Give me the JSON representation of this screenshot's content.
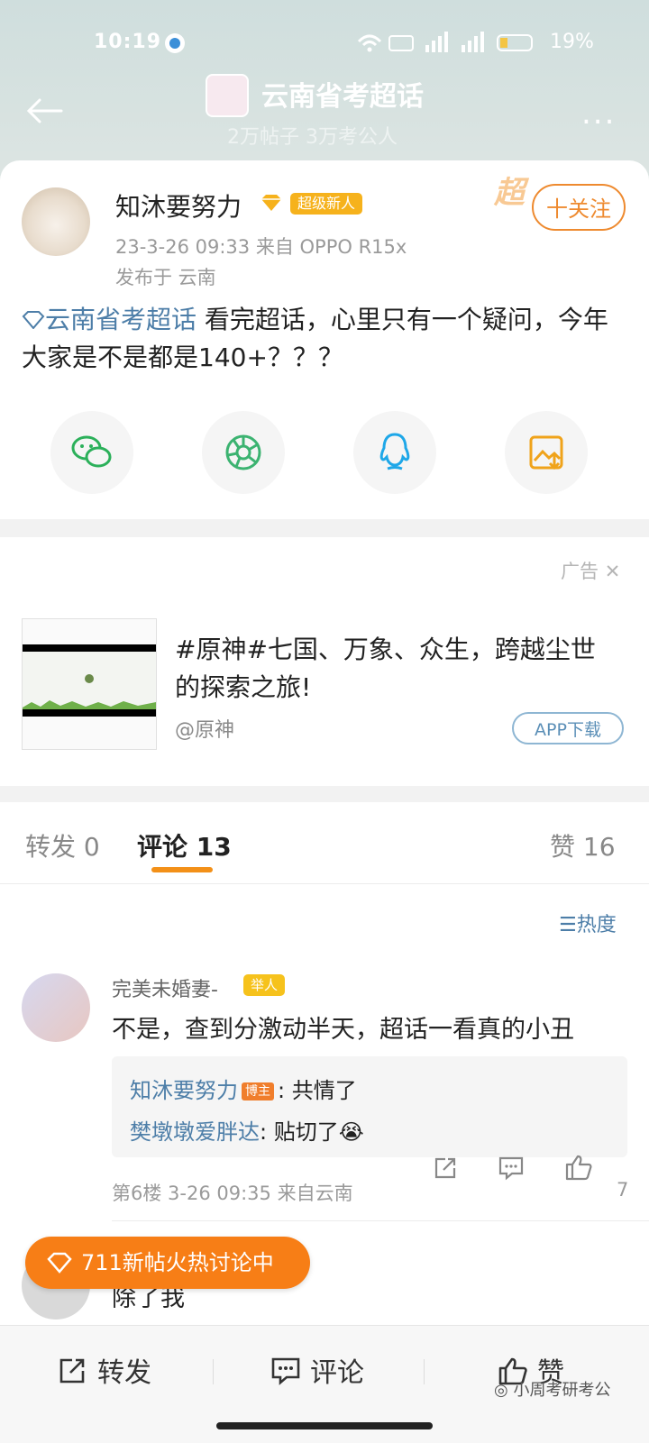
{
  "status": {
    "time": "10:19",
    "battery": "19%"
  },
  "header": {
    "title": "云南省考超话",
    "subtitle": "2万帖子 3万考公人",
    "more": "..."
  },
  "post": {
    "author": "知沐要努力",
    "badge": "超级新人",
    "meta": "23-3-26 09:33  来自 OPPO R15x",
    "location": "发布于 云南",
    "follow_label": "十关注",
    "topic_link": "云南省考超话",
    "text": " 看完超话，心里只有一个疑问，今年大家是不是都是140+？？？",
    "share_icons": [
      "wechat-icon",
      "moments-icon",
      "qq-icon",
      "save-image-icon"
    ]
  },
  "ad": {
    "label": "广告",
    "title": "#原神#七国、万象、众生，跨越尘世的探索之旅!",
    "source": "@原神",
    "button": "APP下载"
  },
  "tabs": {
    "repost": "转发 0",
    "comment": "评论 13",
    "like": "赞 16",
    "sort": "热度"
  },
  "comments": [
    {
      "user": "完美未婚妻-",
      "badge": "举人",
      "text": "不是，查到分激动半天，超话一看真的小丑",
      "replies": [
        {
          "user": "知沐要努力",
          "tag": "博主",
          "text": ": 共情了"
        },
        {
          "user": "樊墩墩爱胖达",
          "text": ": 贴切了😭"
        }
      ],
      "meta": "第6楼  3-26 09:35  来自云南",
      "likes": "7"
    },
    {
      "text": "除了我"
    }
  ],
  "hot_pill": "711新帖火热讨论中",
  "bottom": {
    "repost": "转发",
    "comment": "评论",
    "like": "赞"
  },
  "watermark": "小周考研考公"
}
